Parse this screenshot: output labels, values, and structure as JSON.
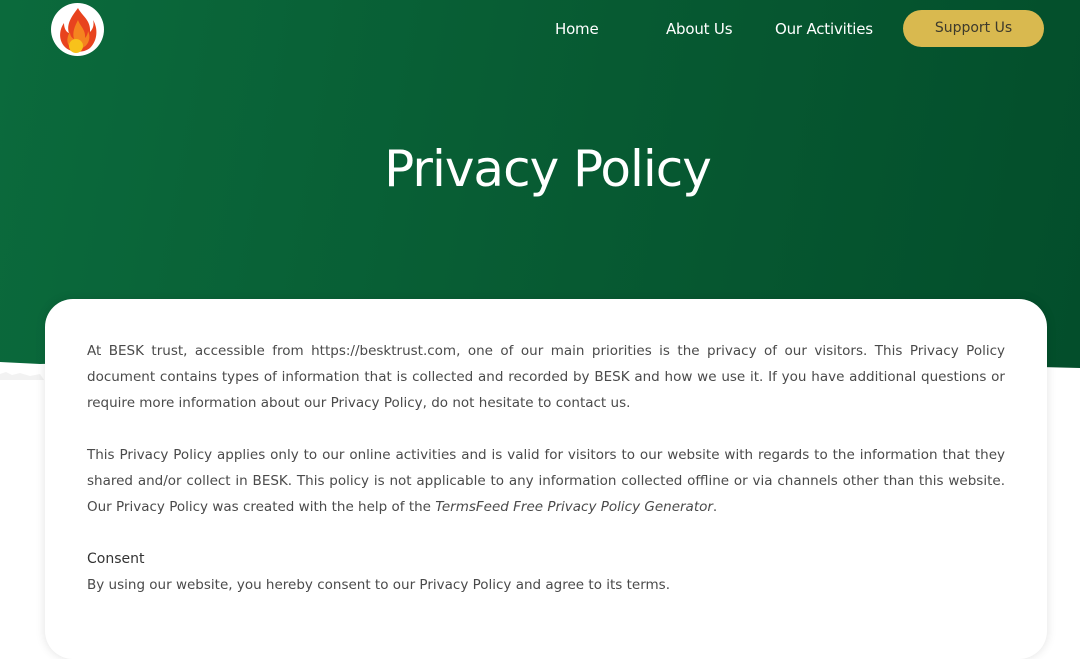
{
  "header": {
    "logo_name": "flame-logo",
    "nav": [
      {
        "label": "Home"
      },
      {
        "label": "About Us"
      },
      {
        "label": "Our Activities"
      }
    ],
    "support_label": "Support Us"
  },
  "hero": {
    "title": "Privacy Policy"
  },
  "content": {
    "p1": "At BESK trust, accessible from https://besktrust.com, one of our main priorities is the privacy of our visitors. This Privacy Policy document contains types of information that is collected and recorded by BESK and how we use it. If you have additional questions or require more information about our Privacy Policy, do not hesitate to contact us.",
    "p2_text": "This Privacy Policy applies only to our online activities and is valid for visitors to our website with regards to the information that they shared and/or collect in BESK. This policy is not applicable to any information collected offline or via channels other than this website. Our Privacy Policy was created with the help of the ",
    "p2_link": "TermsFeed Free Privacy Policy Generator",
    "p2_end": ".",
    "consent_heading": "Consent",
    "consent_text": "By using our website, you hereby consent to our Privacy Policy and agree to its terms."
  },
  "colors": {
    "hero_green": "#075a32",
    "button_gold": "#d9b94f",
    "flame_red": "#e8431e",
    "flame_orange": "#f5841f",
    "flame_yellow": "#f8c21b"
  }
}
